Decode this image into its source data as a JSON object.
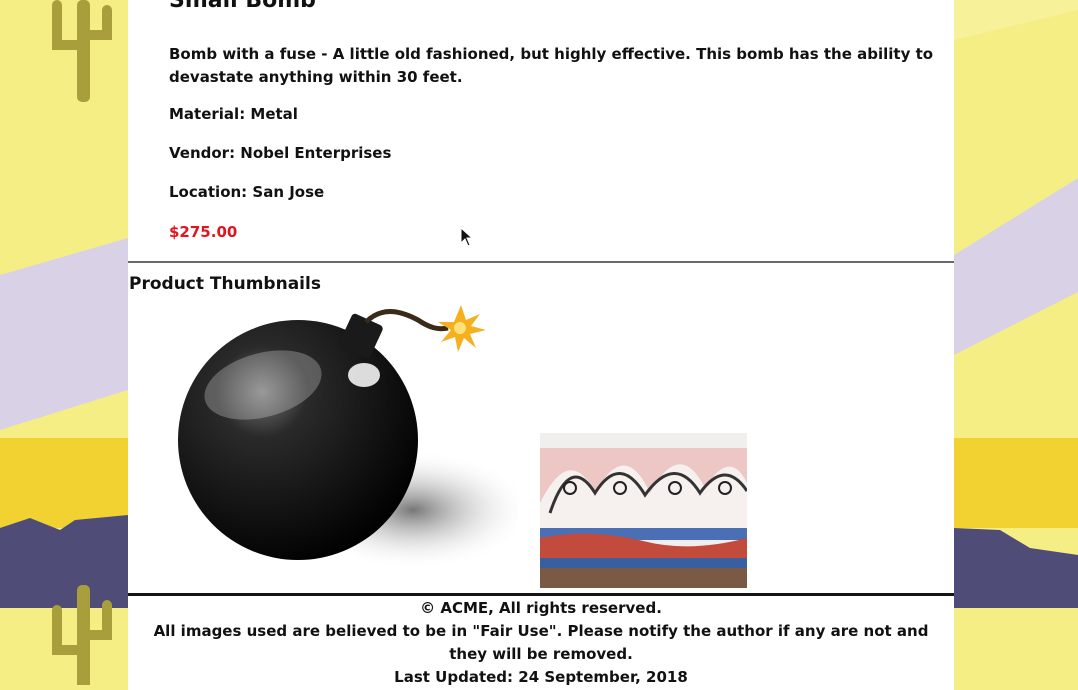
{
  "product": {
    "title": "Small Bomb",
    "description": "Bomb with a fuse - A little old fashioned, but highly effective. This bomb has the ability to devastate anything within 30 feet.",
    "material": "Material: Metal",
    "vendor": "Vendor: Nobel Enterprises",
    "location": "Location: San Jose",
    "price": "$275.00"
  },
  "thumbnails": {
    "heading": "Product Thumbnails",
    "items": [
      "bomb-thumbnail",
      "wave-art-thumbnail"
    ]
  },
  "footer": {
    "copyright": "© ACME, All rights reserved.",
    "fair_use": "All images used are believed to be in \"Fair Use\". Please notify the author if any are not and they will be removed.",
    "updated": "Last Updated: 24 September, 2018"
  },
  "colors": {
    "price": "#e4141e",
    "background_yellow": "#f5ee84",
    "background_lavender": "#d9d2e6",
    "mountain": "#4f4d77",
    "cactus": "#a99e3c"
  }
}
